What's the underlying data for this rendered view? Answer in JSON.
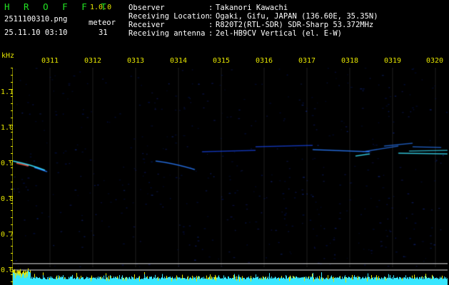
{
  "app": {
    "name": "H R O F F T",
    "version": "1.0.0"
  },
  "file": {
    "name": "2511100310.png",
    "datetime": "25.11.10 03:10"
  },
  "meteor": {
    "label": "meteor",
    "count": "31"
  },
  "info": [
    {
      "key": "Observer",
      "value": "Takanori Kawachi"
    },
    {
      "key": "Receiving Location",
      "value": "Ogaki, Gifu, JAPAN (136.60E, 35.35N)"
    },
    {
      "key": "Receiver",
      "value": "R820T2(RTL-SDR) SDR-Sharp 53.372MHz"
    },
    {
      "key": "Receiving antenna",
      "value": "2el-HB9CV Vertical (el. E-W)"
    }
  ],
  "sep": ":",
  "axis": {
    "y_unit": "kHz",
    "y_ticks": [
      "1.1",
      "1.0",
      "0.9",
      "0.8",
      "0.7",
      "0.6"
    ],
    "x_ticks": [
      "0311",
      "0312",
      "0313",
      "0314",
      "0315",
      "0316",
      "0317",
      "0318",
      "0319",
      "0320"
    ]
  },
  "colors": {
    "title": "#22e222",
    "label": "#e6e600",
    "text": "#ffffff",
    "carrier": "#39e6ff",
    "background": "#000000"
  }
}
